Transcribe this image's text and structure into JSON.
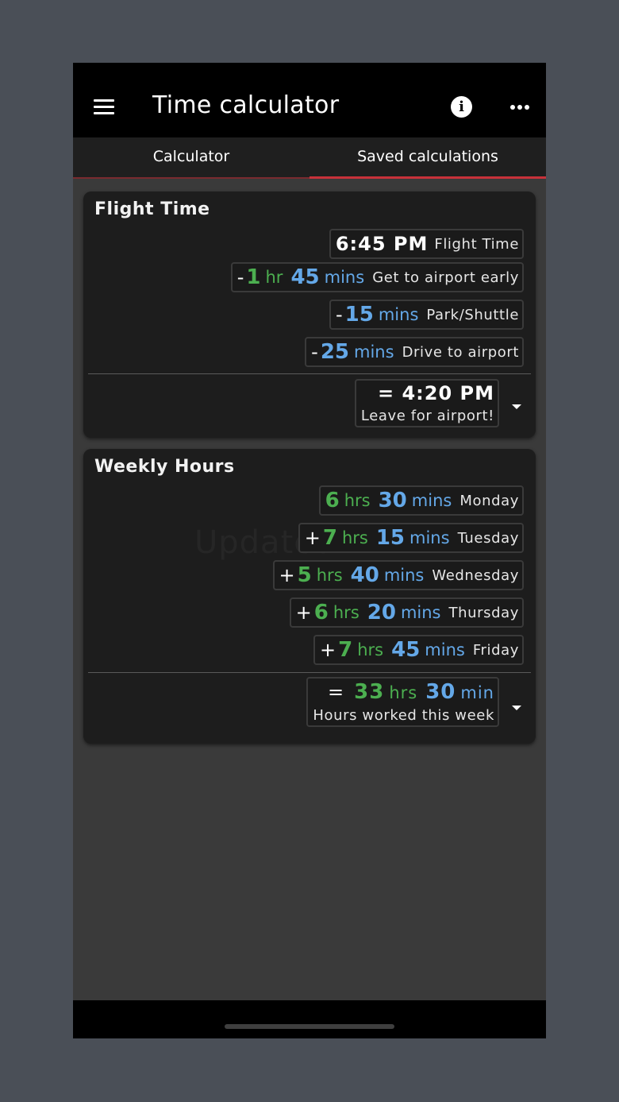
{
  "appbar": {
    "title": "Time calculator",
    "menu_icon": "menu-icon",
    "info_icon": "info-icon",
    "info_glyph": "i",
    "more_icon": "more-horizontal-icon"
  },
  "tabs": [
    {
      "label": "Calculator",
      "active": false
    },
    {
      "label": "Saved calculations",
      "active": true
    }
  ],
  "colors": {
    "hours_green": "#4caf50",
    "minutes_blue": "#64a8e8",
    "tab_indicator": "#c8313a"
  },
  "cards": [
    {
      "title": "Flight Time",
      "rows": [
        {
          "sign": "",
          "time": "6:45 PM",
          "label": "Flight Time"
        },
        {
          "sign": "-",
          "hours": "1",
          "hours_unit": "hr",
          "mins": "45",
          "mins_unit": "mins",
          "label": "Get to airport early"
        },
        {
          "sign": "-",
          "mins": "15",
          "mins_unit": "mins",
          "label": "Park/Shuttle"
        },
        {
          "sign": "-",
          "mins": "25",
          "mins_unit": "mins",
          "label": "Drive to airport"
        }
      ],
      "result": {
        "value": "= 4:20 PM",
        "label": "Leave for airport!"
      }
    },
    {
      "title": "Weekly Hours",
      "watermark": "Updated",
      "rows": [
        {
          "sign": "",
          "hours": "6",
          "hours_unit": "hrs",
          "mins": "30",
          "mins_unit": "mins",
          "label": "Monday"
        },
        {
          "sign": "+",
          "hours": "7",
          "hours_unit": "hrs",
          "mins": "15",
          "mins_unit": "mins",
          "label": "Tuesday"
        },
        {
          "sign": "+",
          "hours": "5",
          "hours_unit": "hrs",
          "mins": "40",
          "mins_unit": "mins",
          "label": "Wednesday"
        },
        {
          "sign": "+",
          "hours": "6",
          "hours_unit": "hrs",
          "mins": "20",
          "mins_unit": "mins",
          "label": "Thursday"
        },
        {
          "sign": "+",
          "hours": "7",
          "hours_unit": "hrs",
          "mins": "45",
          "mins_unit": "mins",
          "label": "Friday"
        }
      ],
      "result": {
        "eq": "=",
        "hours": "33",
        "hours_unit": "hrs",
        "mins": "30",
        "mins_unit": "min",
        "label": "Hours worked this week"
      }
    }
  ]
}
